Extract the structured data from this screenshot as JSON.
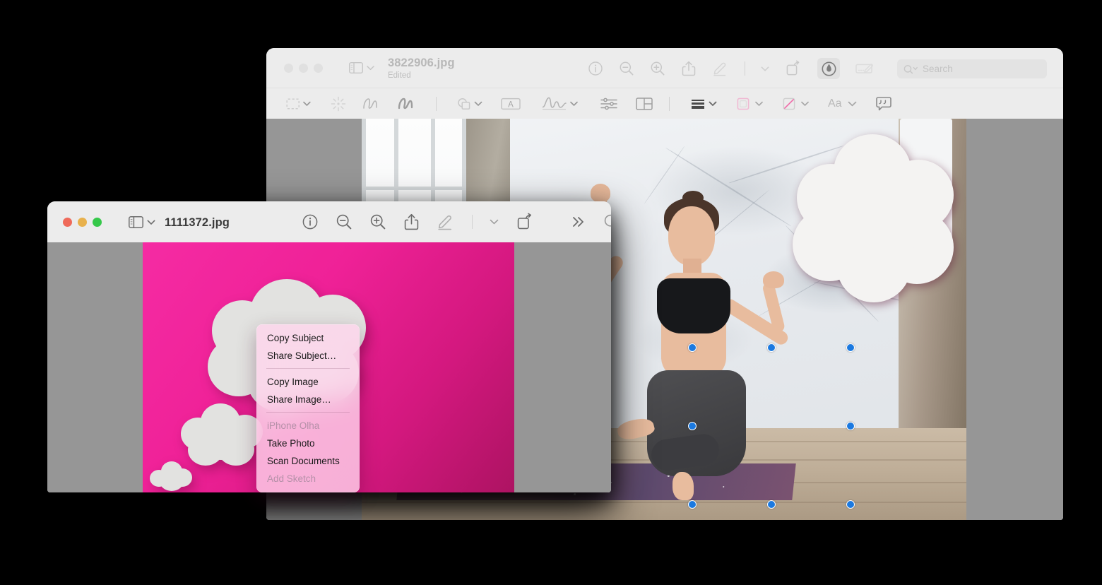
{
  "app": "Preview",
  "back_window": {
    "name": "back-window",
    "title": "3822906.jpg",
    "subtitle": "Edited",
    "traffic_lights": [
      "close",
      "minimize",
      "zoom"
    ],
    "traffic_state": "inactive",
    "sidebar_toggle": {
      "icon": "sidebar-icon",
      "chevron": "chevron-down-icon"
    },
    "toolbar": [
      {
        "name": "info-button",
        "icon": "info-circle-icon"
      },
      {
        "name": "zoom-out-button",
        "icon": "magnifier-minus-icon"
      },
      {
        "name": "zoom-in-button",
        "icon": "magnifier-plus-icon"
      },
      {
        "name": "share-button",
        "icon": "share-up-arrow-icon"
      },
      {
        "name": "markup-button",
        "icon": "pen-underline-icon"
      },
      {
        "name": "markup-options-button",
        "icon": "chevron-down-icon"
      },
      {
        "name": "rotate-button",
        "icon": "rotate-left-icon"
      },
      {
        "name": "annotate-button",
        "icon": "circle-pen-icon",
        "selected": true
      },
      {
        "name": "sign-button",
        "icon": "signature-pad-icon"
      }
    ],
    "search": {
      "placeholder": "Search",
      "icon": "search-chevron-icon"
    },
    "markup_toolbar": [
      {
        "name": "selection-tool",
        "icon": "dashed-rect-icon",
        "chevron": true
      },
      {
        "name": "instant-alpha-tool",
        "icon": "sparkle-icon"
      },
      {
        "name": "sketch-tool",
        "icon": "sketch-squiggle-icon"
      },
      {
        "name": "draw-tool",
        "icon": "draw-squiggle-icon"
      },
      {
        "name": "shapes-tool",
        "icon": "shapes-icon",
        "chevron": true
      },
      {
        "name": "text-tool",
        "icon": "text-box-a-icon"
      },
      {
        "name": "sign-tool",
        "icon": "signature-icon",
        "chevron": true
      },
      {
        "name": "adjust-color-tool",
        "icon": "sliders-icon"
      },
      {
        "name": "adjust-size-tool",
        "icon": "crop-frame-icon"
      },
      {
        "name": "shape-style-tool",
        "icon": "line-weight-icon",
        "chevron": true
      },
      {
        "name": "border-color-tool",
        "icon": "border-color-square-icon",
        "chevron": true
      },
      {
        "name": "fill-color-tool",
        "icon": "fill-color-slash-icon",
        "chevron": true
      },
      {
        "name": "text-style-tool",
        "icon": "text-aa-icon",
        "label": "Aa",
        "chevron": true
      },
      {
        "name": "annotation-tool",
        "icon": "speech-bubble-quote-icon"
      }
    ],
    "image_alt": "Woman in black sports bra and gray leggings balancing in a yoga pose on a galaxy-print mat in a bright marble studio",
    "selection_handles": 8,
    "selection_handle_color": "#1b79e0",
    "matte_color": "#969696"
  },
  "front_window": {
    "name": "front-window",
    "title": "1111372.jpg",
    "traffic_lights": [
      "close",
      "minimize",
      "zoom"
    ],
    "traffic_state": "active",
    "traffic_colors": {
      "close": "#ef6a5a",
      "minimize": "#e8b14c",
      "zoom": "#35c84a"
    },
    "sidebar_toggle": {
      "icon": "sidebar-icon",
      "chevron": "chevron-down-icon"
    },
    "toolbar": [
      {
        "name": "info-button",
        "icon": "info-circle-icon"
      },
      {
        "name": "zoom-out-button",
        "icon": "magnifier-minus-icon"
      },
      {
        "name": "zoom-in-button",
        "icon": "magnifier-plus-icon"
      },
      {
        "name": "share-button",
        "icon": "share-up-arrow-icon"
      },
      {
        "name": "markup-button",
        "icon": "pen-underline-icon"
      },
      {
        "name": "markup-options-button",
        "icon": "chevron-down-icon"
      },
      {
        "name": "rotate-button",
        "icon": "rotate-left-icon"
      },
      {
        "name": "overflow-button",
        "icon": "double-chevron-right-icon"
      },
      {
        "name": "search-button",
        "icon": "search-icon"
      }
    ],
    "image_alt": "White paper thought-bubble cloud cutouts on a magenta pink gradient background",
    "background_colors": {
      "light": "#f52ba3",
      "dark": "#ad1362"
    },
    "matte_color": "#969696"
  },
  "context_menu": {
    "name": "image-context-menu",
    "groups": [
      {
        "items": [
          {
            "label": "Copy Subject",
            "enabled": true
          },
          {
            "label": "Share Subject…",
            "enabled": true
          }
        ]
      },
      {
        "items": [
          {
            "label": "Copy Image",
            "enabled": true
          },
          {
            "label": "Share Image…",
            "enabled": true
          }
        ]
      },
      {
        "items": [
          {
            "label": "iPhone Olha",
            "enabled": false
          },
          {
            "label": "Take Photo",
            "enabled": true
          },
          {
            "label": "Scan Documents",
            "enabled": true
          },
          {
            "label": "Add Sketch",
            "enabled": false
          }
        ]
      }
    ]
  }
}
